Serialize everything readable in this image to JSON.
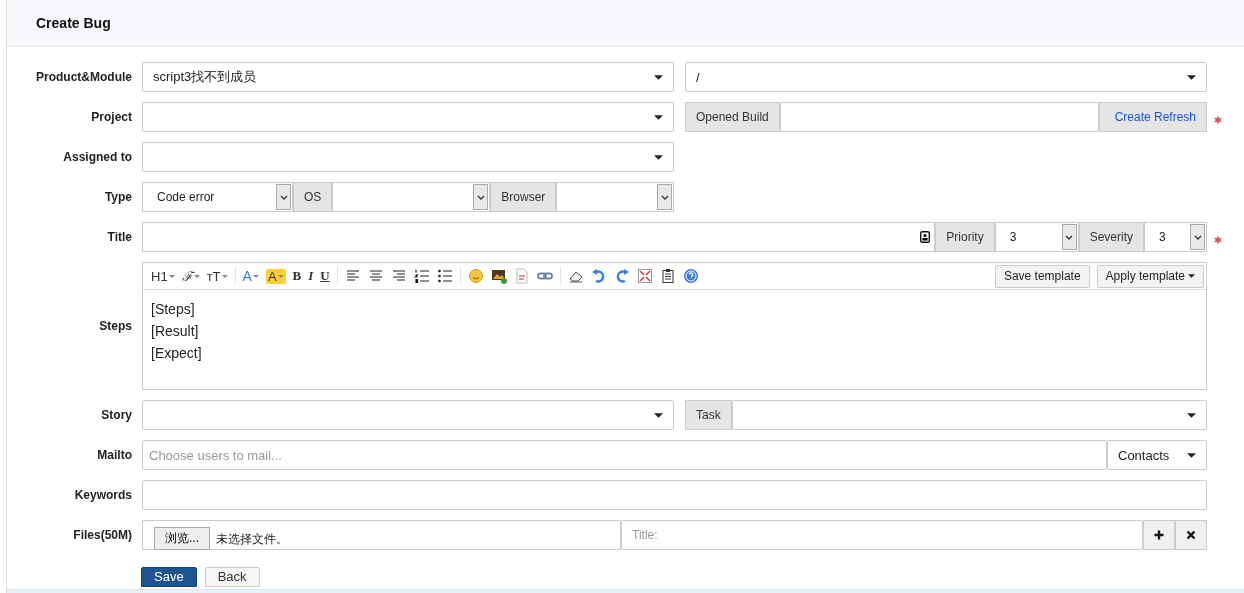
{
  "page_title": "Create Bug",
  "product_module": {
    "label": "Product&Module",
    "product": "script3找不到成员",
    "module": "/"
  },
  "project": {
    "label": "Project"
  },
  "opened_build": {
    "label": "Opened Build",
    "link": "Create Refresh",
    "required": true
  },
  "assigned_to": {
    "label": "Assigned to"
  },
  "type": {
    "label": "Type",
    "value": "Code error",
    "os_label": "OS",
    "browser_label": "Browser"
  },
  "title": {
    "label": "Title",
    "priority_label": "Priority",
    "priority": "3",
    "severity_label": "Severity",
    "severity": "3",
    "required": true
  },
  "steps": {
    "label": "Steps",
    "toolbar_groups": [
      [
        {
          "kind": "heading",
          "label": "H1"
        },
        {
          "kind": "font",
          "label": "ℱ"
        },
        {
          "kind": "size",
          "label": "ᴛT"
        }
      ],
      [
        {
          "kind": "color",
          "label": "A"
        },
        {
          "kind": "highlight",
          "label": "A"
        },
        {
          "kind": "bold",
          "label": "B"
        },
        {
          "kind": "italic",
          "label": "I"
        },
        {
          "kind": "underline",
          "label": "U"
        }
      ],
      [
        {
          "kind": "align-left"
        },
        {
          "kind": "align-center"
        },
        {
          "kind": "align-right"
        },
        {
          "kind": "ordered-list"
        },
        {
          "kind": "unordered-list"
        }
      ],
      [
        {
          "kind": "emoji"
        },
        {
          "kind": "image"
        },
        {
          "kind": "code"
        },
        {
          "kind": "link"
        }
      ],
      [
        {
          "kind": "eraser"
        },
        {
          "kind": "undo"
        },
        {
          "kind": "redo"
        },
        {
          "kind": "fullscreen"
        },
        {
          "kind": "paste"
        },
        {
          "kind": "help"
        }
      ]
    ],
    "save_template": "Save template",
    "apply_template": "Apply template",
    "lines": [
      "[Steps]",
      "[Result]",
      "[Expect]"
    ]
  },
  "story": {
    "label": "Story",
    "task_label": "Task"
  },
  "mailto": {
    "label": "Mailto",
    "placeholder": "Choose users to mail...",
    "contacts": "Contacts"
  },
  "keywords": {
    "label": "Keywords"
  },
  "files": {
    "label": "Files(50M)",
    "browse": "浏览...",
    "status": "未选择文件。",
    "title_placeholder": "Title:"
  },
  "buttons": [
    {
      "label": "Save",
      "kind": "primary"
    },
    {
      "label": "Back",
      "kind": "default"
    }
  ]
}
